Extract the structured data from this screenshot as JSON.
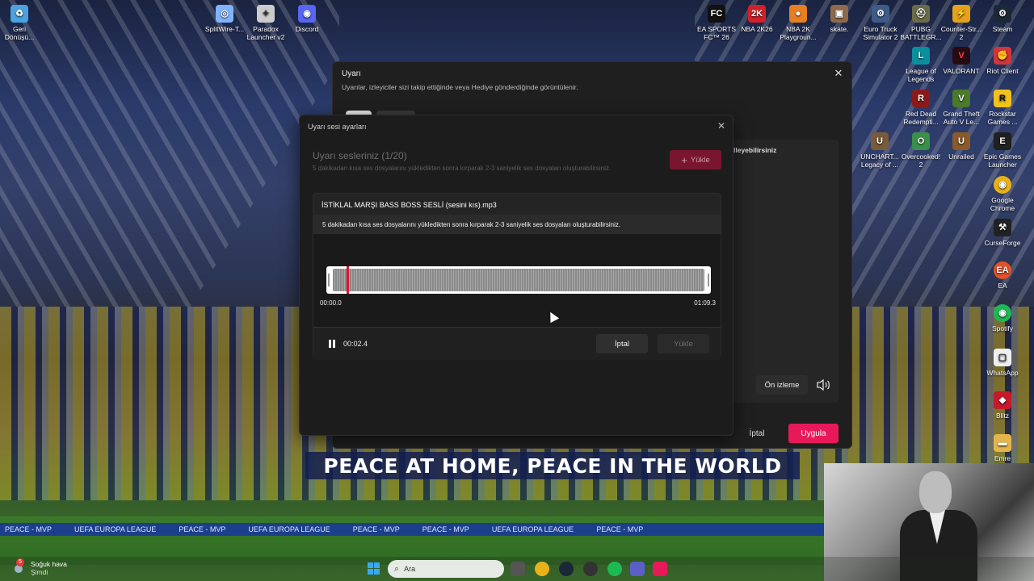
{
  "desktop_left": [
    {
      "label": "Geri Dönüşü...",
      "glyph": "♻",
      "color": "#4aa3df"
    },
    {
      "label": "SplitWire-T...",
      "glyph": "◎",
      "color": "#7fb3ff"
    },
    {
      "label": "Paradox Launcher v2",
      "glyph": "✦",
      "color": "#cccccc"
    },
    {
      "label": "Discord",
      "glyph": "◉",
      "color": "#5865f2"
    }
  ],
  "desktop_right": [
    {
      "label": "EA SPORTS FC™ 26",
      "glyph": "FC",
      "color": "#111111"
    },
    {
      "label": "NBA 2K26",
      "glyph": "2K",
      "color": "#d0202a"
    },
    {
      "label": "NBA 2K Playgroun...",
      "glyph": "●",
      "color": "#e67e22"
    },
    {
      "label": "skate.",
      "glyph": "▣",
      "color": "#8e6a4a"
    },
    {
      "label": "Euro Truck Simulator 2",
      "glyph": "⚙",
      "color": "#3d5c8a"
    },
    {
      "label": "PUBG BATTLEGR...",
      "glyph": "⛑",
      "color": "#6b6b4a"
    },
    {
      "label": "Counter-Str... 2",
      "glyph": "⚡",
      "color": "#e5a21a"
    },
    {
      "label": "Steam",
      "glyph": "⚙",
      "color": "#1b2838"
    },
    {
      "label": "League of Legends",
      "glyph": "L",
      "color": "#0a8f9e"
    },
    {
      "label": "VALORANT",
      "glyph": "V",
      "color": "#2a0a12"
    },
    {
      "label": "Riot Client",
      "glyph": "✊",
      "color": "#d13639"
    },
    {
      "label": "Red Dead Redempti...",
      "glyph": "R",
      "color": "#8b1a1a"
    },
    {
      "label": "Grand Theft Auto V Le...",
      "glyph": "V",
      "color": "#4a7a2a"
    },
    {
      "label": "Rockstar Games ...",
      "glyph": "R",
      "color": "#f2c21a"
    },
    {
      "label": "UNCHART... Legacy of ...",
      "glyph": "U",
      "color": "#7a5a3a"
    },
    {
      "label": "Overcooked! 2",
      "glyph": "O",
      "color": "#3a8f4a"
    },
    {
      "label": "Unrailed",
      "glyph": "U",
      "color": "#8a5a2a"
    },
    {
      "label": "Epic Games Launcher",
      "glyph": "E",
      "color": "#202020"
    },
    {
      "label": "Google Chrome",
      "glyph": "◉",
      "color": "#e8b21a"
    },
    {
      "label": "CurseForge",
      "glyph": "⚒",
      "color": "#222222"
    },
    {
      "label": "EA",
      "glyph": "EA",
      "color": "#e2522a"
    },
    {
      "label": "Spotify",
      "glyph": "◉",
      "color": "#1db954"
    },
    {
      "label": "WhatsApp",
      "glyph": "▢",
      "color": "#f0f0f0"
    },
    {
      "label": "Blitz",
      "glyph": "◆",
      "color": "#c41a2a"
    },
    {
      "label": "Emre",
      "glyph": "▬",
      "color": "#e3b54a"
    }
  ],
  "back_window": {
    "title": "Uyarı",
    "subtitle": "Uyarılar, izleyiciler sizi takip ettiğinde veya Hediye gönderdiğinde görüntülenir.",
    "peek_text": "lleyebilirsiniz",
    "preview_label": "Ön izleme",
    "cancel_label": "İptal",
    "apply_label": "Uygula",
    "accent": "#e8195a"
  },
  "dialog": {
    "title": "Uyarı sesi ayarları",
    "heading": "Uyarı sesleriniz (1/20)",
    "description": "5 dakikadan kısa ses dosyalarını yükledikten sonra kırparak 2-3 saniyelik ses dosyaları oluşturabilirsiniz.",
    "upload_label": "Yükle",
    "editor": {
      "filename": "İSTİKLAL MARŞI BASS BOSS SESLİ (sesini kıs).mp3",
      "info": "5 dakikadan kısa ses dosyalarını yükledikten sonra kırparak 2-3 saniyelik ses dosyaları oluşturabilirsiniz.",
      "start_time": "00:00.0",
      "end_time": "01:09.3",
      "current_time": "00:02.4",
      "cancel_label": "İptal",
      "upload_label": "Yükle",
      "playhead_color": "#e0142e"
    }
  },
  "wallpaper": {
    "banner": "PEACE AT HOME, PEACE IN THE WORLD",
    "board": [
      "PEACE - MVP",
      "UEFA EUROPA LEAGUE",
      "PEACE - MVP",
      "UEFA EUROPA LEAGUE",
      "PEACE - MVP",
      "PEACE - MVP",
      "UEFA EUROPA LEAGUE",
      "PEACE - MVP"
    ]
  },
  "taskbar": {
    "weather_title": "Soğuk hava",
    "weather_sub": "Şimdi",
    "weather_badge": "5",
    "search_placeholder": "Ara",
    "apps": [
      "file-explorer",
      "chrome",
      "steam",
      "spotify-ish",
      "spotify",
      "teams",
      "tiktok"
    ]
  }
}
